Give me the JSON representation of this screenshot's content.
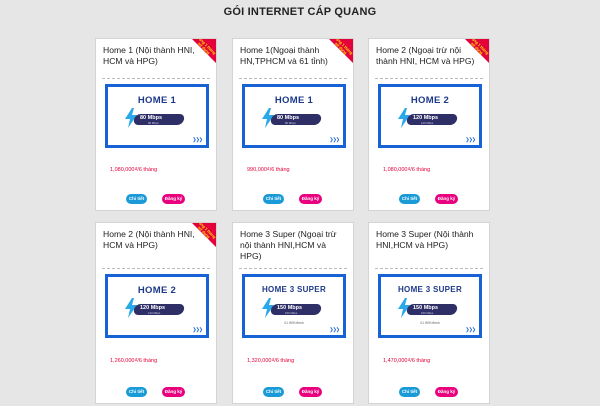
{
  "title": "GÓI INTERNET CÁP QUANG",
  "colors": {
    "price": "#e4003a",
    "detail_btn": "#1a9ad6",
    "register_btn": "#e9007e",
    "banner": "#1763d6",
    "ribbon": "#e4003a"
  },
  "ribbon_text": "Tặng 1 tháng sử dụng",
  "buttons": {
    "detail": "Chi tiết",
    "register": "Đăng ký"
  },
  "cards": [
    {
      "title": "Home 1 (Nội thành HNI, HCM và HPG)",
      "banner_name": "HOME 1",
      "speed": "80 Mbps",
      "speed_sub": "80 Mbps",
      "price": "1,080,000₫/6 tháng"
    },
    {
      "title": "Home 1(Ngoại thành HN,TPHCM và 61 tỉnh)",
      "banner_name": "HOME 1",
      "speed": "80 Mbps",
      "speed_sub": "80 Mbps",
      "price": "990,000₫/6 tháng"
    },
    {
      "title": "Home 2 (Ngoại trừ nội thành HNI, HCM và HPG)",
      "banner_name": "HOME 2",
      "speed": "120 Mbps",
      "speed_sub": "120 Mbps",
      "price": "1,080,000₫/6 tháng"
    },
    {
      "title": "Home 2 (Nội thành HNI, HCM và HPG)",
      "banner_name": "HOME 2",
      "speed": "120 Mbps",
      "speed_sub": "120 Mbps",
      "price": "1,260,000₫/6 tháng"
    },
    {
      "title": "Home 3 Super (Ngoại trừ nội thành HNI,HCM và HPG)",
      "banner_name": "HOME 3 SUPER",
      "speed": "150 Mbps",
      "speed_sub": "150 Mbps",
      "sub": "01 Wifi Mesh",
      "price": "1,320,000₫/6 tháng"
    },
    {
      "title": "Home 3 Super (Nội thành HNI,HCM và HPG)",
      "banner_name": "HOME 3 SUPER",
      "speed": "150 Mbps",
      "speed_sub": "150 Mbps",
      "sub": "01 Wifi Mesh",
      "price": "1,470,000₫/6 tháng"
    }
  ]
}
